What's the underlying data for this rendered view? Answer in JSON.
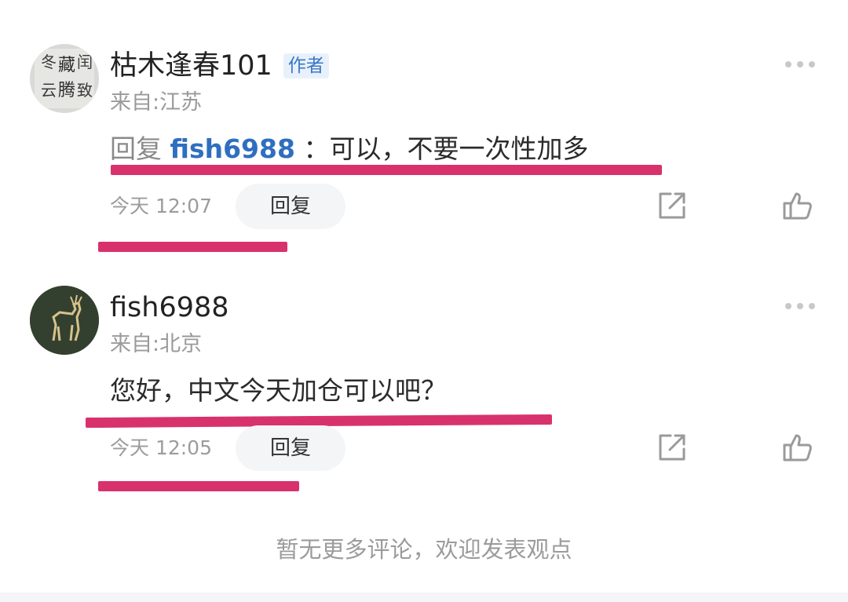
{
  "comments": [
    {
      "username": "枯木逢春101",
      "badge": "作者",
      "location": "来自:江苏",
      "reply_prefix": "回复",
      "mention": "fish6988",
      "text": "：可以，不要一次性加多",
      "time": "今天 12:07",
      "reply_label": "回复"
    },
    {
      "username": "fish6988",
      "location": "来自:北京",
      "text": "您好，中文今天加仓可以吧？",
      "time": "今天 12:05",
      "reply_label": "回复"
    }
  ],
  "footer": {
    "message": "暂无更多评论，欢迎发表观点"
  },
  "colors": {
    "mention": "#2f6ec0",
    "badge_bg": "#e8f1fb",
    "annotation_underline": "#d8326c"
  },
  "icons": {
    "more": "more-dots-icon",
    "share": "share-icon",
    "like": "thumbs-up-icon"
  }
}
